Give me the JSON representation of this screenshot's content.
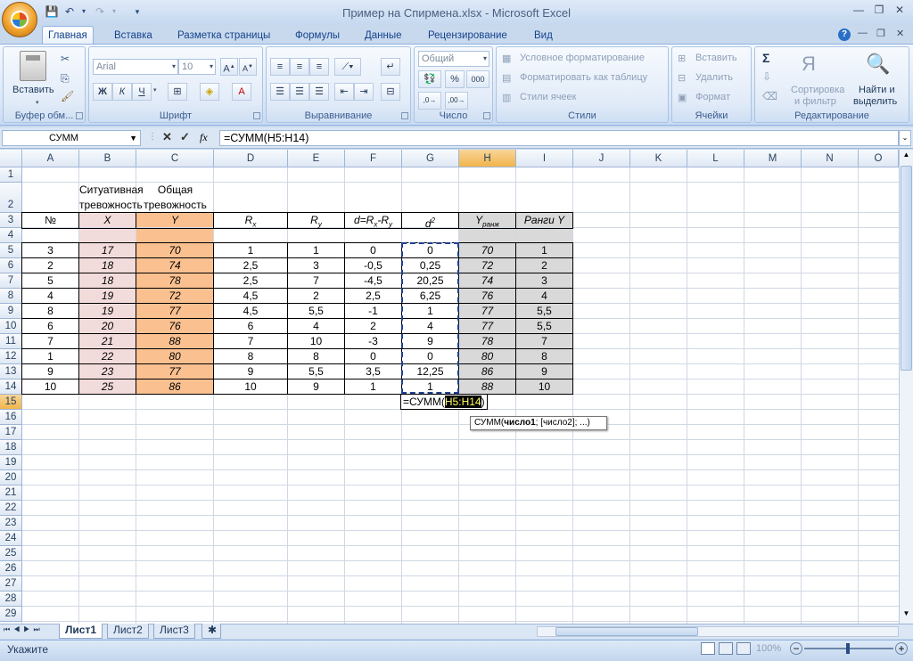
{
  "window": {
    "title": "Пример на Спирмена.xlsx - Microsoft Excel"
  },
  "tabs": [
    "Главная",
    "Вставка",
    "Разметка страницы",
    "Формулы",
    "Данные",
    "Рецензирование",
    "Вид"
  ],
  "ribbon": {
    "clipboard": {
      "label": "Буфер обм...",
      "paste": "Вставить"
    },
    "font": {
      "label": "Шрифт",
      "name": "Arial",
      "size": "10"
    },
    "align": {
      "label": "Выравнивание"
    },
    "number": {
      "label": "Число",
      "format": "Общий"
    },
    "styles": {
      "label": "Стили",
      "cond": "Условное форматирование",
      "table": "Форматировать как таблицу",
      "cell": "Стили ячеек"
    },
    "cells": {
      "label": "Ячейки",
      "insert": "Вставить",
      "delete": "Удалить",
      "format": "Формат"
    },
    "editing": {
      "label": "Редактирование",
      "sort1": "Сортировка",
      "sort2": "и фильтр",
      "find1": "Найти и",
      "find2": "выделить"
    }
  },
  "formula_bar": {
    "name_box": "СУММ",
    "formula": "=СУММ(H5:H14)",
    "fx": "fx"
  },
  "columns": [
    "A",
    "B",
    "C",
    "D",
    "E",
    "F",
    "G",
    "H",
    "I",
    "J",
    "K",
    "L",
    "M",
    "N",
    "O"
  ],
  "rows": [
    "1",
    "2",
    "3",
    "4",
    "5",
    "6",
    "7",
    "8",
    "9",
    "10",
    "11",
    "12",
    "13",
    "14",
    "15",
    "16",
    "17",
    "18",
    "19",
    "20",
    "21",
    "22",
    "23",
    "24",
    "25",
    "26",
    "27",
    "28",
    "29"
  ],
  "headers_row2": {
    "c1": "Ситуативная",
    "c2": "тревожность",
    "d1": "Общая",
    "d2": "тревожность"
  },
  "headers_row3": {
    "B": "№",
    "C": "X",
    "D": "Y",
    "E": "R",
    "E_sub": "x",
    "F": "R",
    "F_sub": "y",
    "G": "d=R",
    "G_sub1": "x",
    "G_mid": "-R",
    "G_sub2": "y",
    "H": "d",
    "H_sup": "2",
    "I": "Y",
    "I_sub": "ранж",
    "J": "Ранги Y"
  },
  "table": [
    [
      "3",
      "17",
      "70",
      "1",
      "1",
      "0",
      "0",
      "70",
      "1"
    ],
    [
      "2",
      "18",
      "74",
      "2,5",
      "3",
      "-0,5",
      "0,25",
      "72",
      "2"
    ],
    [
      "5",
      "18",
      "78",
      "2,5",
      "7",
      "-4,5",
      "20,25",
      "74",
      "3"
    ],
    [
      "4",
      "19",
      "72",
      "4,5",
      "2",
      "2,5",
      "6,25",
      "76",
      "4"
    ],
    [
      "8",
      "19",
      "77",
      "4,5",
      "5,5",
      "-1",
      "1",
      "77",
      "5,5"
    ],
    [
      "6",
      "20",
      "76",
      "6",
      "4",
      "2",
      "4",
      "77",
      "5,5"
    ],
    [
      "7",
      "21",
      "88",
      "7",
      "10",
      "-3",
      "9",
      "78",
      "7"
    ],
    [
      "1",
      "22",
      "80",
      "8",
      "8",
      "0",
      "0",
      "80",
      "8"
    ],
    [
      "9",
      "23",
      "77",
      "9",
      "5,5",
      "3,5",
      "12,25",
      "86",
      "9"
    ],
    [
      "10",
      "25",
      "86",
      "10",
      "9",
      "1",
      "1",
      "88",
      "10"
    ]
  ],
  "editing_cell": {
    "prefix": "=СУММ(",
    "range": "H5:H14",
    "suffix": ")"
  },
  "tooltip": {
    "fn": "СУММ(",
    "arg1": "число1",
    "rest": "; [число2]; ...)"
  },
  "sheets": [
    "Лист1",
    "Лист2",
    "Лист3"
  ],
  "status": {
    "mode": "Укажите",
    "zoom": "100%"
  },
  "colors": {
    "x_fill": "#f2dcdb",
    "y_fill": "#fac090",
    "gray_fill": "#d9d9d9",
    "accent": "#15428b"
  }
}
